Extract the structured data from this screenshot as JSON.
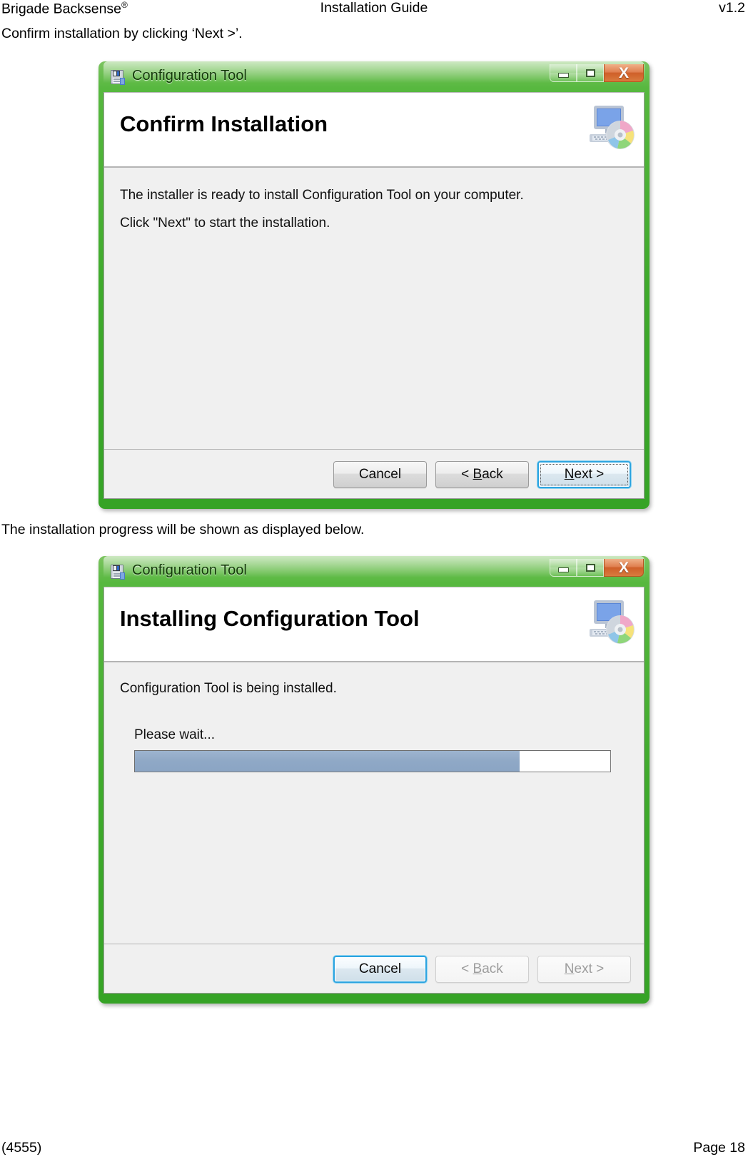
{
  "page": {
    "header": {
      "left": "Brigade Backsense",
      "left_sup": "®",
      "center": "Installation Guide",
      "right": "v1.2"
    },
    "footer": {
      "left": "(4555)",
      "right": "Page 18"
    },
    "paragraphs": {
      "p1": "Confirm installation by clicking ‘Next >’.",
      "p2": "The installation progress will be shown as displayed below."
    }
  },
  "dialog_confirm": {
    "titlebar": {
      "title": "Configuration Tool",
      "icon": "installer-package-icon",
      "minimize_label": "",
      "maximize_label": "",
      "close_label": "X"
    },
    "banner": {
      "heading": "Confirm Installation",
      "icon": "computer-cd-icon"
    },
    "body": {
      "line1": "The installer is ready to install Configuration Tool on your computer.",
      "line2": "Click \"Next\" to start the installation."
    },
    "buttons": {
      "cancel": "Cancel",
      "back_prefix": "< ",
      "back_accel": "B",
      "back_suffix": "ack",
      "next_accel": "N",
      "next_suffix": "ext >"
    }
  },
  "dialog_installing": {
    "titlebar": {
      "title": "Configuration Tool",
      "icon": "installer-package-icon",
      "minimize_label": "",
      "maximize_label": "",
      "close_label": "X"
    },
    "banner": {
      "heading": "Installing Configuration Tool",
      "icon": "computer-cd-icon"
    },
    "body": {
      "line1": "Configuration Tool is being installed.",
      "wait_label": "Please wait..."
    },
    "progress": {
      "percent": 81,
      "fill_color": "#8fa8c6",
      "track_color": "#ffffff"
    },
    "buttons": {
      "cancel": "Cancel",
      "back_prefix": "< ",
      "back_accel": "B",
      "back_suffix": "ack",
      "next_accel": "N",
      "next_suffix": "ext >"
    }
  },
  "theme": {
    "window_frame_green": "#3faa2c",
    "focus_blue": "#2ca4e0",
    "close_orange": "#cf5f29"
  }
}
